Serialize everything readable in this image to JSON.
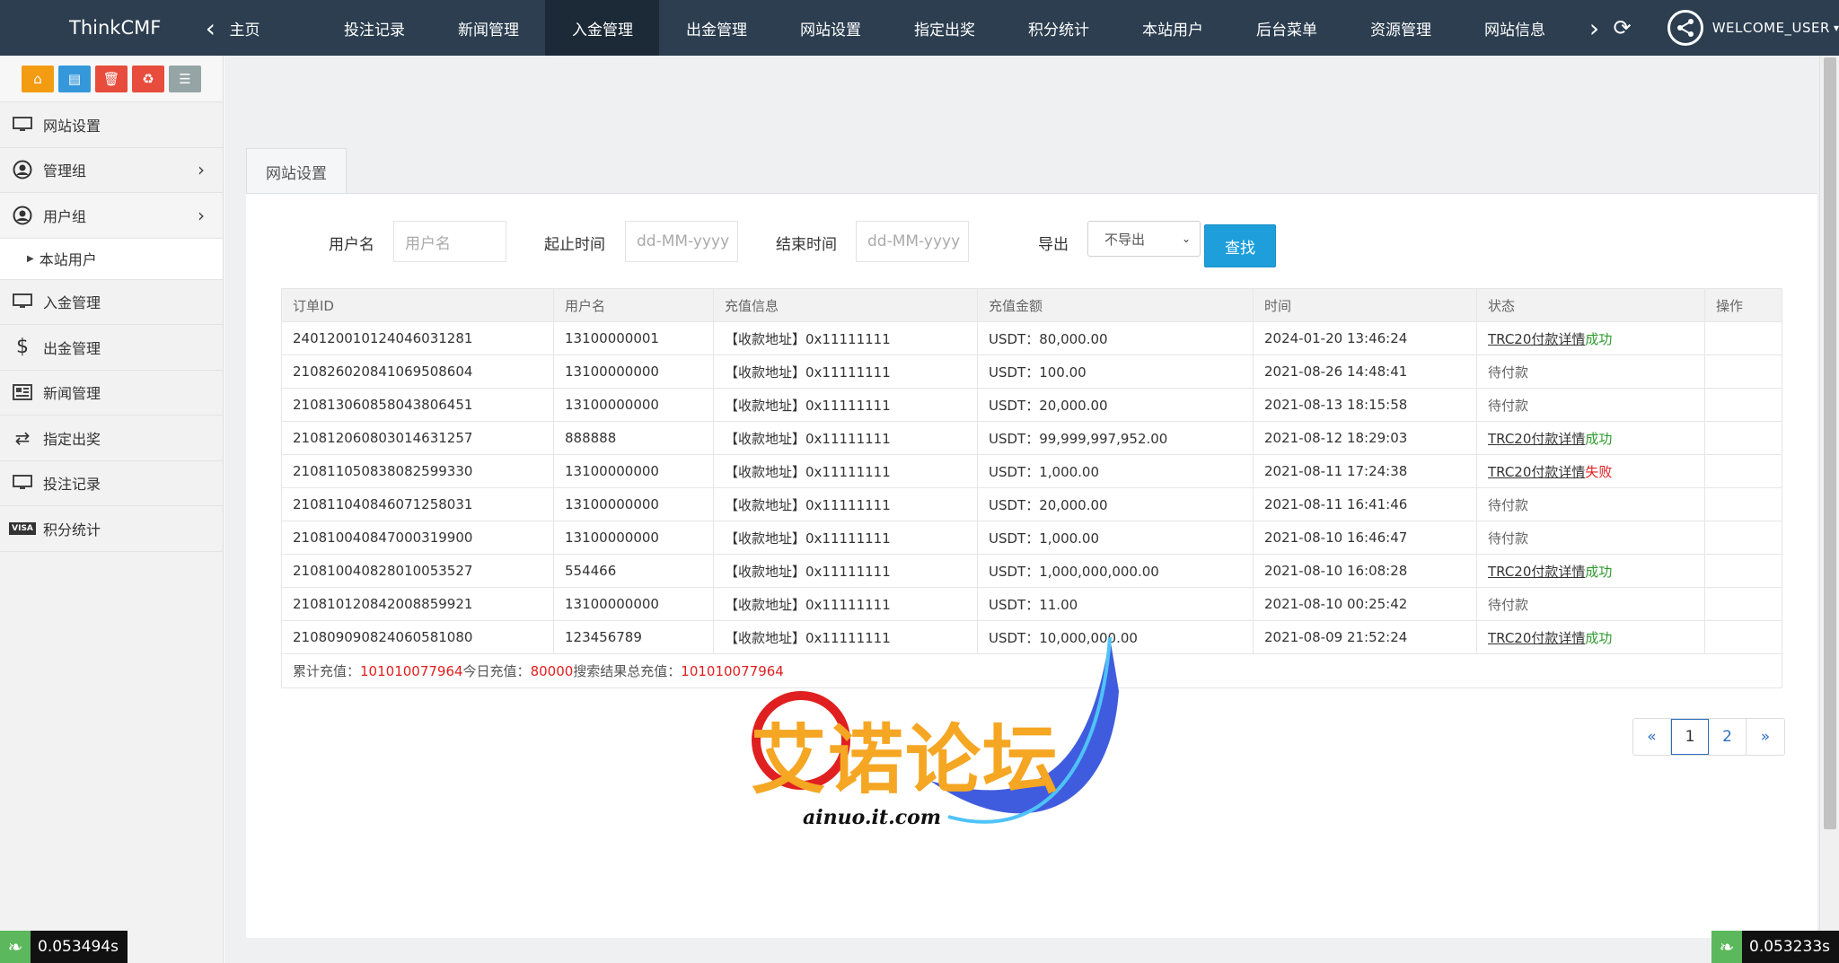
{
  "topbar": {
    "brand": "ThinkCMF",
    "home": "主页",
    "items": [
      "投注记录",
      "新闻管理",
      "入金管理",
      "出金管理",
      "网站设置",
      "指定出奖",
      "积分统计",
      "本站用户",
      "后台菜单",
      "资源管理",
      "网站信息"
    ],
    "active_index": 2,
    "user": "WELCOME_USER"
  },
  "sidebar": {
    "items": [
      {
        "label": "网站设置",
        "icon": "monitor-icon"
      },
      {
        "label": "管理组",
        "icon": "user-circle-icon",
        "chevron": true
      },
      {
        "label": "用户组",
        "icon": "user-circle-icon",
        "chevron": true,
        "open": true
      },
      {
        "label": "本站用户",
        "sub": true
      },
      {
        "label": "入金管理",
        "icon": "monitor-icon"
      },
      {
        "label": "出金管理",
        "icon": "dollar-icon"
      },
      {
        "label": "新闻管理",
        "icon": "newspaper-icon"
      },
      {
        "label": "指定出奖",
        "icon": "exchange-icon"
      },
      {
        "label": "投注记录",
        "icon": "monitor-icon"
      },
      {
        "label": "积分统计",
        "icon": "visa-icon"
      }
    ]
  },
  "panel": {
    "tab": "网站设置",
    "filter": {
      "username_label": "用户名",
      "username_placeholder": "用户名",
      "start_label": "起止时间",
      "start_placeholder": "dd-MM-yyyy",
      "end_label": "结束时间",
      "end_placeholder": "dd-MM-yyyy",
      "export_label": "导出",
      "export_value": "不导出",
      "search_button": "查找"
    },
    "table": {
      "headers": [
        "订单ID",
        "用户名",
        "充值信息",
        "充值金额",
        "时间",
        "状态",
        "操作"
      ],
      "rows": [
        {
          "id": "240120010124046031281",
          "user": "13100000001",
          "info": "【收款地址】0x11111111",
          "amount": "USDT：80,000.00",
          "time": "2024-01-20 13:46:24",
          "link": "TRC20付款详情",
          "status": "成功",
          "type": "ok"
        },
        {
          "id": "210826020841069508604",
          "user": "13100000000",
          "info": "【收款地址】0x11111111",
          "amount": "USDT：100.00",
          "time": "2021-08-26 14:48:41",
          "link": "",
          "status": "待付款",
          "type": "pending"
        },
        {
          "id": "210813060858043806451",
          "user": "13100000000",
          "info": "【收款地址】0x11111111",
          "amount": "USDT：20,000.00",
          "time": "2021-08-13 18:15:58",
          "link": "",
          "status": "待付款",
          "type": "pending"
        },
        {
          "id": "210812060803014631257",
          "user": "888888",
          "info": "【收款地址】0x11111111",
          "amount": "USDT：99,999,997,952.00",
          "time": "2021-08-12 18:29:03",
          "link": "TRC20付款详情",
          "status": "成功",
          "type": "ok"
        },
        {
          "id": "210811050838082599330",
          "user": "13100000000",
          "info": "【收款地址】0x11111111",
          "amount": "USDT：1,000.00",
          "time": "2021-08-11 17:24:38",
          "link": "TRC20付款详情",
          "status": "失败",
          "type": "fail"
        },
        {
          "id": "210811040846071258031",
          "user": "13100000000",
          "info": "【收款地址】0x11111111",
          "amount": "USDT：20,000.00",
          "time": "2021-08-11 16:41:46",
          "link": "",
          "status": "待付款",
          "type": "pending"
        },
        {
          "id": "210810040847000319900",
          "user": "13100000000",
          "info": "【收款地址】0x11111111",
          "amount": "USDT：1,000.00",
          "time": "2021-08-10 16:46:47",
          "link": "",
          "status": "待付款",
          "type": "pending"
        },
        {
          "id": "210810040828010053527",
          "user": "554466",
          "info": "【收款地址】0x11111111",
          "amount": "USDT：1,000,000,000.00",
          "time": "2021-08-10 16:08:28",
          "link": "TRC20付款详情",
          "status": "成功",
          "type": "ok"
        },
        {
          "id": "210810120842008859921",
          "user": "13100000000",
          "info": "【收款地址】0x11111111",
          "amount": "USDT：11.00",
          "time": "2021-08-10 00:25:42",
          "link": "",
          "status": "待付款",
          "type": "pending"
        },
        {
          "id": "210809090824060581080",
          "user": "123456789",
          "info": "【收款地址】0x11111111",
          "amount": "USDT：10,000,000.00",
          "time": "2021-08-09 21:52:24",
          "link": "TRC20付款详情",
          "status": "成功",
          "type": "ok"
        }
      ],
      "summary": {
        "total_label": "累计充值：",
        "total_value": "101010077964",
        "today_label": " 今日充值：",
        "today_value": "80000",
        "search_label": " 搜索结果总充值：",
        "search_value": "101010077964"
      }
    },
    "pager": [
      "«",
      "1",
      "2",
      "»"
    ],
    "pager_current": "1"
  },
  "watermark": {
    "text": "艾诺论坛",
    "url": "ainuo.it.com"
  },
  "timers": {
    "left": "0.053494s",
    "right": "0.053233s"
  },
  "colors": {
    "topbar": "#2c3e50",
    "active": "#1c2a38",
    "primary_button": "#1e9fdb",
    "success": "#2e9a2e",
    "fail": "#e02020"
  }
}
